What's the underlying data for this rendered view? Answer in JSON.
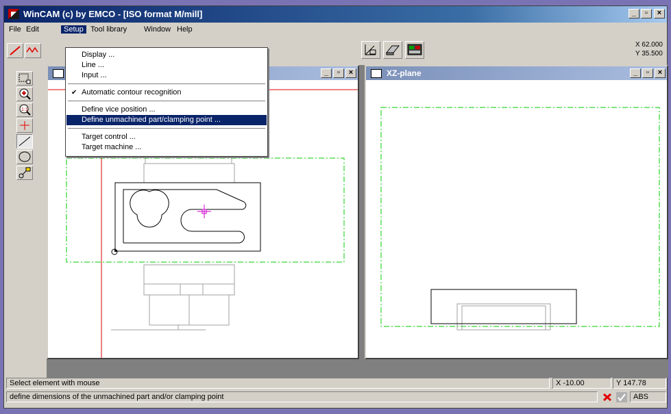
{
  "window": {
    "title": "WinCAM (c) by EMCO - [ISO format M/mill]",
    "buttons": {
      "minimize": "_",
      "restore": "▫",
      "close": "×"
    }
  },
  "menu": [
    "File",
    "Edit",
    "Setup",
    "Tool library",
    "Window",
    "Help"
  ],
  "setup_menu": {
    "items": [
      {
        "label": "Display ...",
        "checked": false,
        "highlighted": false
      },
      {
        "label": "Line ...",
        "checked": false,
        "highlighted": false
      },
      {
        "label": "Input ...",
        "checked": false,
        "highlighted": false
      },
      {
        "label": "Automatic contour recognition",
        "checked": true,
        "highlighted": false
      },
      {
        "label": "Define vice position ...",
        "checked": false,
        "highlighted": false
      },
      {
        "label": "Define unmachined part/clamping point ...",
        "checked": false,
        "highlighted": true
      },
      {
        "label": "Target control ...",
        "checked": false,
        "highlighted": false
      },
      {
        "label": "Target machine ...",
        "checked": false,
        "highlighted": false
      }
    ],
    "check_glyph": "✔"
  },
  "coords": {
    "x": "X 62.000",
    "y": "Y 35.500"
  },
  "left_tools": [
    "zoom-window-icon",
    "zoom-in-icon",
    "zoom-fit-icon",
    "crosshair-icon",
    "line-icon",
    "circle-icon",
    "point-icon"
  ],
  "xy_window": {
    "title": ""
  },
  "xz_window": {
    "title": "XZ-plane"
  },
  "status": {
    "message": "Select element with mouse",
    "x": "X -10.00",
    "y": "Y 147.78",
    "hint": "define dimensions of the unmachined part and/or clamping point",
    "abs": "ABS"
  },
  "colors": {
    "titlebar": "#0a246a",
    "highlight": "#0a246a",
    "axis_red": "#e00000",
    "dashdot_green": "#00cc00",
    "cursor_magenta": "#cc00cc",
    "fixture_gray": "#a0a0a0"
  }
}
